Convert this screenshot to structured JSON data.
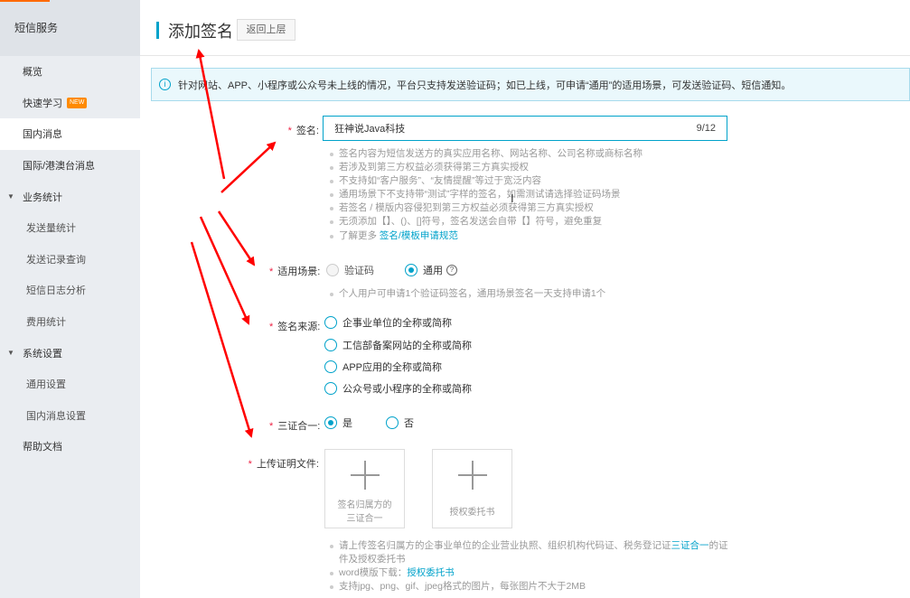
{
  "sidebar": {
    "header": "短信服务",
    "items": [
      {
        "label": "概览"
      },
      {
        "label": "快速学习",
        "badge": "NEW"
      },
      {
        "label": "国内消息"
      },
      {
        "label": "国际/港澳台消息"
      }
    ],
    "groups": [
      {
        "label": "业务统计",
        "items": [
          "发送量统计",
          "发送记录查询",
          "短信日志分析",
          "费用统计"
        ]
      },
      {
        "label": "系统设置",
        "items": [
          "通用设置",
          "国内消息设置"
        ]
      }
    ],
    "help": "帮助文档"
  },
  "header": {
    "title": "添加签名",
    "back_label": "返回上层"
  },
  "notice": "针对网站、APP、小程序或公众号未上线的情况，平台只支持发送验证码；如已上线，可申请“通用”的适用场景，可发送验证码、短信通知。",
  "form": {
    "required_mark": "*",
    "signature": {
      "label": "签名:",
      "value": "狂神说Java科技",
      "counter": "9/12",
      "tips": [
        "签名内容为短信发送方的真实应用名称、网站名称、公司名称或商标名称",
        "若涉及到第三方权益必须获得第三方真实授权",
        "不支持如“客户服务”、“友情提醒”等过于宽泛内容",
        "通用场景下不支持带“测试”字样的签名，如需测试请选择验证码场景",
        "若签名 / 模版内容侵犯到第三方权益必须获得第三方真实授权",
        "无须添加【】、()、[]符号，签名发送会自带【】符号，避免重复"
      ],
      "more_prefix": "了解更多",
      "more_link": "签名/模板申请规范"
    },
    "scene": {
      "label": "适用场景:",
      "options": [
        {
          "label": "验证码",
          "selected": false,
          "disabled": true
        },
        {
          "label": "通用",
          "selected": true,
          "disabled": false
        }
      ],
      "help_glyph": "?",
      "tip": "个人用户可申请1个验证码签名，通用场景签名一天支持申请1个"
    },
    "source": {
      "label": "签名来源:",
      "options": [
        "企事业单位的全称或简称",
        "工信部备案网站的全称或简称",
        "APP应用的全称或简称",
        "公众号或小程序的全称或简称"
      ]
    },
    "three_in_one": {
      "label": "三证合一:",
      "options": [
        {
          "label": "是",
          "selected": true
        },
        {
          "label": "否",
          "selected": false
        }
      ]
    },
    "upload": {
      "label": "上传证明文件:",
      "boxes": [
        {
          "line1": "签名归属方的",
          "line2": "三证合一"
        },
        {
          "line1": "授权委托书",
          "line2": ""
        }
      ],
      "tips": {
        "t1a": "请上传签名归属方的企事业单位的企业营业执照、组织机构代码证、税务登记证",
        "t1link": "三证合一",
        "t1b": "的证",
        "t1c": "件及授权委托书",
        "t2a": "word模版下载：",
        "t2link": "授权委托书",
        "t3": "支持jpg、png、gif、jpeg格式的图片，每张图片不大于2MB"
      }
    }
  },
  "colors": {
    "accent": "#00a2ca",
    "annotation": "#ff0000",
    "required": "#e24",
    "sidebar_bg": "#eaedf1"
  },
  "cursor_glyph": "I"
}
